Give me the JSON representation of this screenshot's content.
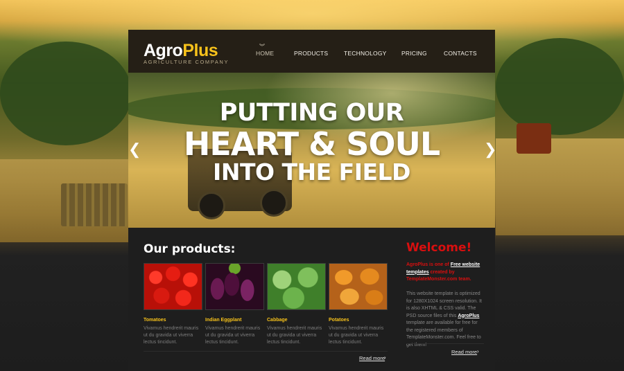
{
  "logo": {
    "part1": "Agro",
    "part2": "Plus",
    "tagline": "AGRICULTURE COMPANY"
  },
  "nav": [
    "HOME",
    "PRODUCTS",
    "TECHNOLOGY",
    "PRICING",
    "CONTACTS"
  ],
  "slider": {
    "line1": "PUTTING OUR",
    "line2": "HEART & SOUL",
    "line3": "INTO THE FIELD",
    "prev": "❮",
    "next": "❯"
  },
  "products": {
    "title": "Our products:",
    "items": [
      {
        "name": "Tomatoes",
        "desc": "Vivamus hendrerit mauris ut du gravida ut viverra lectus tincidunt."
      },
      {
        "name": "Indian Eggplant",
        "desc": "Vivamus hendrerit mauris ut du gravida ut viverra lectus tincidunt."
      },
      {
        "name": "Cabbage",
        "desc": "Vivamus hendrerit mauris ut du gravida ut viverra lectus tincidunt."
      },
      {
        "name": "Potatoes",
        "desc": "Vivamus hendrerit mauris ut du gravida ut viverra lectus tincidunt."
      }
    ],
    "read_more": "Read more",
    "chevron": "›"
  },
  "welcome": {
    "title": "Welcome!",
    "intro_red1": "AgroPlus is one of",
    "intro_link": "Free website templates",
    "intro_red2": "created by TemplateMonster.com team.",
    "body1": " This website template is optimized for 1280X1024 screen resolution. It is also XHTML & CSS valid. The PSD source files of this",
    "body_link": "AgroPlus",
    "body2": "template are available for free for the registered members of TemplateMonster.com. Feel free to get them!",
    "read_more": "Read more",
    "chevron": "›"
  },
  "colors": {
    "accent_yellow": "#f7c21b",
    "welcome_red": "#d90f0f",
    "dark_bg": "#1e1e1e"
  }
}
